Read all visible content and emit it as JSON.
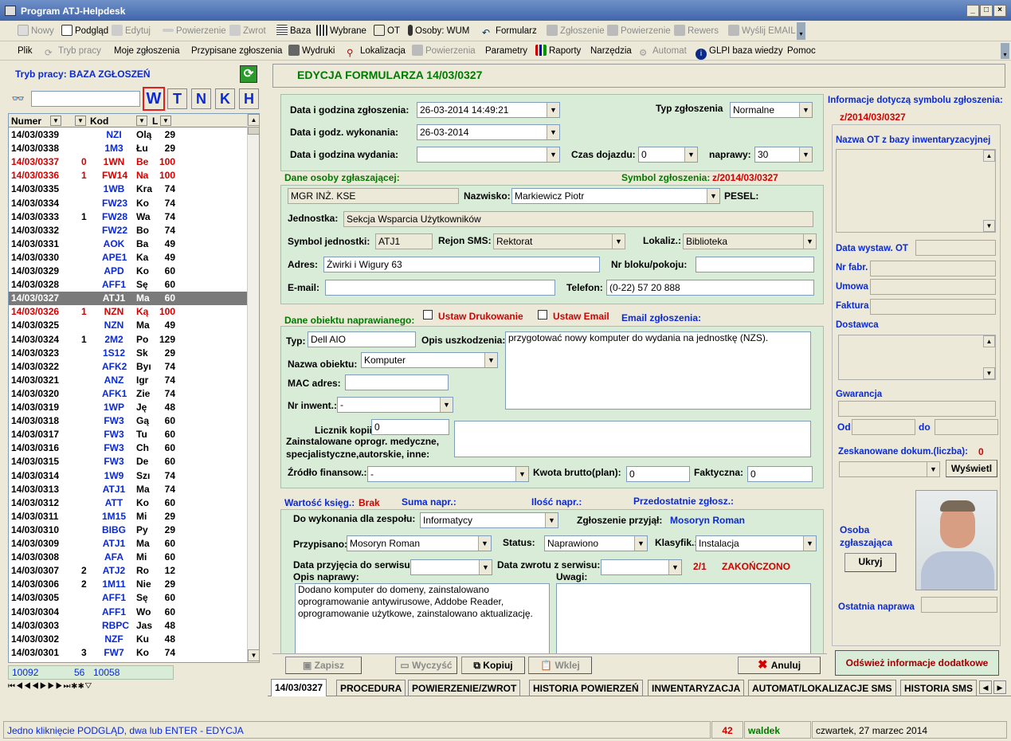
{
  "window": {
    "title": "Program ATJ-Helpdesk"
  },
  "toolbar1": [
    "Nowy",
    "Podgląd",
    "Edytuj",
    "Powierzenie",
    "Zwrot",
    "Baza",
    "Wybrane",
    "OT",
    "Osoby: WUM",
    "Formularz",
    "Zgłoszenie",
    "Powierzenie",
    "Rewers",
    "Wyślij EMAIL"
  ],
  "toolbar2": [
    "Plik",
    "Tryb pracy",
    "Moje zgłoszenia",
    "Przypisane zgłoszenia",
    "Wydruki",
    "Lokalizacja",
    "Powierzenia",
    "Parametry",
    "Raporty",
    "Narzędzia",
    "Automat",
    "GLPI baza wiedzy",
    "Pomoc"
  ],
  "left": {
    "mode_label": "Tryb pracy: BAZA ZGŁOSZEŃ",
    "search_value": "",
    "filter_buttons": [
      "W",
      "T",
      "N",
      "K",
      "H"
    ],
    "columns": [
      "Numer",
      "Kod",
      "L"
    ],
    "rows": [
      [
        "14/03/0339",
        "",
        "NZI",
        "Olą",
        "29",
        "n"
      ],
      [
        "14/03/0338",
        "",
        "1M3",
        "Łu",
        "29",
        "n"
      ],
      [
        "14/03/0337",
        "0",
        "1WN",
        "Be",
        "100",
        "r"
      ],
      [
        "14/03/0336",
        "1",
        "FW14",
        "Na",
        "100",
        "r"
      ],
      [
        "14/03/0335",
        "",
        "1WB",
        "Kra",
        "74",
        "n"
      ],
      [
        "14/03/0334",
        "",
        "FW23",
        "Ko",
        "74",
        "n"
      ],
      [
        "14/03/0333",
        "1",
        "FW28",
        "Wa",
        "74",
        "n"
      ],
      [
        "14/03/0332",
        "",
        "FW22",
        "Bo",
        "74",
        "n"
      ],
      [
        "14/03/0331",
        "",
        "AOK",
        "Ba",
        "49",
        "n"
      ],
      [
        "14/03/0330",
        "",
        "APE1",
        "Ka",
        "49",
        "n"
      ],
      [
        "14/03/0329",
        "",
        "APD",
        "Ko",
        "60",
        "n"
      ],
      [
        "14/03/0328",
        "",
        "AFF1",
        "Sę",
        "60",
        "n"
      ],
      [
        "14/03/0327",
        "",
        "ATJ1",
        "Ma",
        "60",
        "s"
      ],
      [
        "14/03/0326",
        "1",
        "NZN",
        "Ką",
        "100",
        "r"
      ],
      [
        "14/03/0325",
        "",
        "NZN",
        "Ma",
        "49",
        "n"
      ],
      [
        "14/03/0324",
        "1",
        "2M2",
        "Po",
        "129",
        "n"
      ],
      [
        "14/03/0323",
        "",
        "1S12",
        "Sk",
        "29",
        "n"
      ],
      [
        "14/03/0322",
        "",
        "AFK2",
        "Byı",
        "74",
        "n"
      ],
      [
        "14/03/0321",
        "",
        "ANZ",
        "Igr",
        "74",
        "n"
      ],
      [
        "14/03/0320",
        "",
        "AFK1",
        "Zie",
        "74",
        "n"
      ],
      [
        "14/03/0319",
        "",
        "1WP",
        "Ję",
        "48",
        "n"
      ],
      [
        "14/03/0318",
        "",
        "FW3",
        "Gą",
        "60",
        "n"
      ],
      [
        "14/03/0317",
        "",
        "FW3",
        "Tu",
        "60",
        "n"
      ],
      [
        "14/03/0316",
        "",
        "FW3",
        "Ch",
        "60",
        "n"
      ],
      [
        "14/03/0315",
        "",
        "FW3",
        "De",
        "60",
        "n"
      ],
      [
        "14/03/0314",
        "",
        "1W9",
        "Szı",
        "74",
        "n"
      ],
      [
        "14/03/0313",
        "",
        "ATJ1",
        "Ma",
        "74",
        "n"
      ],
      [
        "14/03/0312",
        "",
        "ATT",
        "Ko",
        "60",
        "n"
      ],
      [
        "14/03/0311",
        "",
        "1M15",
        "Mi",
        "29",
        "n"
      ],
      [
        "14/03/0310",
        "",
        "BIBG",
        "Py",
        "29",
        "n"
      ],
      [
        "14/03/0309",
        "",
        "ATJ1",
        "Ma",
        "60",
        "n"
      ],
      [
        "14/03/0308",
        "",
        "AFA",
        "Mi",
        "60",
        "n"
      ],
      [
        "14/03/0307",
        "2",
        "ATJ2",
        "Ro",
        "12",
        "n"
      ],
      [
        "14/03/0306",
        "2",
        "1M11",
        "Nie",
        "29",
        "n"
      ],
      [
        "14/03/0305",
        "",
        "AFF1",
        "Sę",
        "60",
        "n"
      ],
      [
        "14/03/0304",
        "",
        "AFF1",
        "Wo",
        "60",
        "n"
      ],
      [
        "14/03/0303",
        "",
        "RBPC",
        "Jas",
        "48",
        "n"
      ],
      [
        "14/03/0302",
        "",
        "NZF",
        "Ku",
        "48",
        "n"
      ],
      [
        "14/03/0301",
        "3",
        "FW7",
        "Ko",
        "74",
        "n"
      ]
    ],
    "totals": [
      "10092",
      "56",
      "10058"
    ]
  },
  "form": {
    "header": "EDYCJA FORMULARZA 14/03/0327",
    "lbl_data_zgl": "Data i godzina zgłoszenia:",
    "data_zgl": "26-03-2014 14:49:21",
    "lbl_data_wyk": "Data i godz. wykonania:",
    "data_wyk": "26-03-2014",
    "lbl_data_wyd": "Data i godzina wydania:",
    "data_wyd": "",
    "lbl_typ": "Typ zgłoszenia",
    "typ": "Normalne",
    "lbl_dojazd": "Czas dojazdu:",
    "dojazd": "0",
    "lbl_naprawy": "naprawy:",
    "naprawy": "30",
    "lbl_dane_osoby": "Dane osoby zgłaszającej:",
    "lbl_symbol": "Symbol zgłoszenia:",
    "symbol": "z/2014/03/0327",
    "tytul": "MGR INŻ. KSE",
    "lbl_nazwisko": "Nazwisko:",
    "nazwisko": "Markiewicz Piotr",
    "lbl_pesel": "PESEL:",
    "lbl_jednostka": "Jednostka:",
    "jednostka": "Sekcja Wsparcia Użytkowników",
    "lbl_symbol_jedn": "Symbol jednostki:",
    "symbol_jedn": "ATJ1",
    "lbl_rejon": "Rejon SMS:",
    "rejon": "Rektorat",
    "lbl_lokaliz": "Lokaliz.:",
    "lokaliz": "Biblioteka",
    "lbl_adres": "Adres:",
    "adres": "Żwirki i Wigury 63",
    "lbl_blok": "Nr bloku/pokoju:",
    "blok": "",
    "lbl_email": "E-mail:",
    "email": "",
    "lbl_telefon": "Telefon:",
    "telefon": "(0-22) 57 20 888",
    "lbl_dane_obiektu": "Dane obiektu naprawianego:",
    "lbl_ustaw_druk": "Ustaw Drukowanie",
    "lbl_ustaw_email": "Ustaw Email",
    "lbl_email_zgl": "Email zgłoszenia:",
    "lbl_typ_obj": "Typ:",
    "typ_obj": "Dell AIO",
    "lbl_opis_usz": "Opis uszkodzenia:",
    "opis_usz": "przygotować nowy komputer do wydania na jednostkę (NZS).",
    "lbl_nazwa_obj": "Nazwa obiektu:",
    "nazwa_obj": "Komputer",
    "lbl_mac": "MAC adres:",
    "mac": "",
    "lbl_inwent": "Nr inwent.:",
    "inwent": "-",
    "lbl_licznik": "Licznik kopii:",
    "licznik": "0",
    "lbl_oprogr": "Zainstalowane oprogr. medyczne, specjalistyczne,autorskie, inne:",
    "lbl_zrodlo": "Źródło finansow.:",
    "zrodlo": "-",
    "lbl_kwota": "Kwota brutto(plan):",
    "kwota": "0",
    "lbl_fakt": "Faktyczna:",
    "fakt": "0",
    "lbl_wartosc": "Wartość księg.:",
    "wartosc": "Brak",
    "lbl_suma": "Suma napr.:",
    "lbl_ilosc": "Ilość napr.:",
    "lbl_przedost": "Przedostatnie zgłosz.:",
    "lbl_zespol": "Do wykonania dla zespołu:",
    "zespol": "Informatycy",
    "lbl_przyjal": "Zgłoszenie przyjął:",
    "przyjal": "Mosoryn Roman",
    "lbl_przypisano": "Przypisano:",
    "przypisano": "Mosoryn Roman",
    "lbl_status": "Status:",
    "status": "Naprawiono",
    "lbl_klasyfik": "Klasyfik.:",
    "klasyfik": "Instalacja",
    "lbl_przyj_serw": "Data przyjęcia do serwisu:",
    "lbl_zwrot_serw": "Data zwrotu z serwisu:",
    "licznik_status": "2/1",
    "zakonczono": "ZAKOŃCZONO",
    "lbl_opis_napr": "Opis naprawy:",
    "opis_napr": "Dodano komputer do domeny, zainstalowano oprogramowanie antywirusowe, Addobe Reader, oprogramowanie użytkowe, zainstalowano aktualizację.",
    "lbl_uwagi": "Uwagi:",
    "btn_zapisz": "Zapisz",
    "btn_wyczysc": "Wyczyść",
    "btn_kopiuj": "Kopiuj",
    "btn_wklej": "Wklej",
    "btn_anuluj": "Anuluj"
  },
  "tabs": [
    "14/03/0327",
    "PROCEDURA",
    "POWIERZENIE/ZWROT",
    "HISTORIA POWIERZEŃ",
    "INWENTARYZACJA",
    "AUTOMAT/LOKALIZACJE SMS",
    "HISTORIA SMS"
  ],
  "right": {
    "info_title": "Informacje dotyczą symbolu zgłoszenia:",
    "symbol": "z/2014/03/0327",
    "lbl_nazwa_ot": "Nazwa OT z bazy inwentaryzacyjnej",
    "lbl_data_ot": "Data wystaw. OT",
    "lbl_nr_fabr": "Nr fabr.",
    "lbl_umowa": "Umowa",
    "lbl_faktura": "Faktura",
    "lbl_dostawca": "Dostawca",
    "lbl_gwarancja": "Gwarancja",
    "lbl_od": "Od",
    "lbl_do": "do",
    "lbl_zeskan": "Zeskanowane dokum.(liczba):",
    "zeskan": "0",
    "btn_wyswietl": "Wyświetl",
    "lbl_osoba": "Osoba zgłaszająca",
    "btn_ukryj": "Ukryj",
    "lbl_ost_napr": "Ostatnia naprawa",
    "btn_odswiez": "Odśwież informacje dodatkowe"
  },
  "statusbar": {
    "hint": "Jedno kliknięcie PODGLĄD, dwa lub ENTER - EDYCJA",
    "count": "42",
    "user": "waldek",
    "date": "czwartek, 27 marzec 2014"
  },
  "colors": {
    "accent_blue": "#0a2ad8",
    "alert_red": "#d40000",
    "ok_green": "#007a00",
    "panel_green": "#d8ecd8"
  }
}
